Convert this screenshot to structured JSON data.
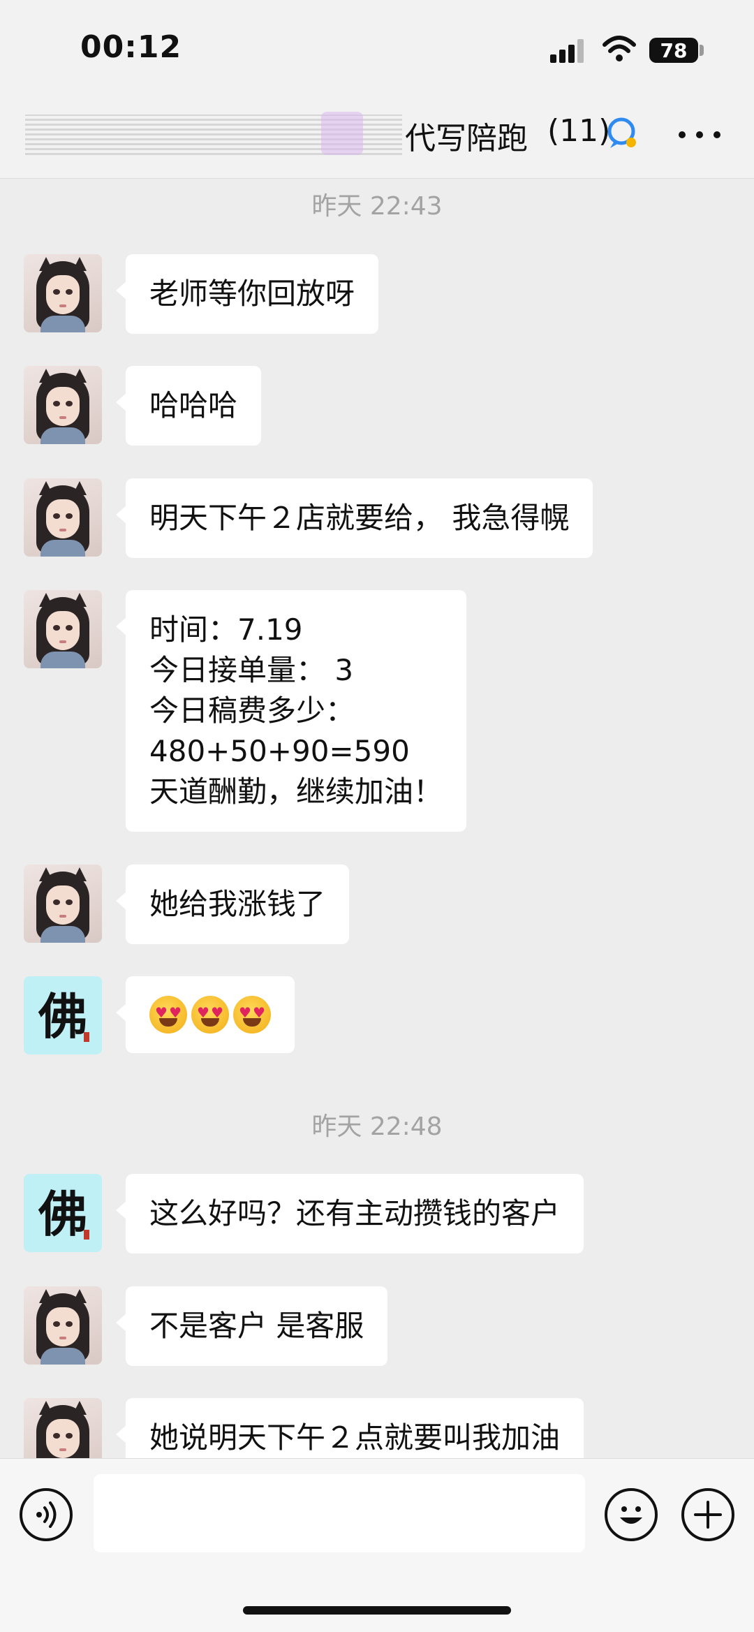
{
  "status_bar": {
    "time": "00:12",
    "battery": "78"
  },
  "header": {
    "title": "代写陪跑",
    "member_count": "(11)"
  },
  "timestamps": [
    "昨天 22:43",
    "昨天 22:48"
  ],
  "messages": [
    {
      "sender": "girl-avatar",
      "lines": [
        "老师等你回放呀"
      ]
    },
    {
      "sender": "girl-avatar",
      "lines": [
        "哈哈哈"
      ]
    },
    {
      "sender": "girl-avatar",
      "lines": [
        "明天下午２店就要给，  我急得幌"
      ]
    },
    {
      "sender": "girl-avatar",
      "lines": [
        "时间：7.19",
        "今日接单量：  3",
        "今日稿费多少：",
        "480+50+90=590",
        "天道酬勤，继续加油！"
      ]
    },
    {
      "sender": "girl-avatar",
      "lines": [
        "她给我涨钱了"
      ]
    },
    {
      "sender": "fo-avatar",
      "emoji": [
        "heart-eyes-emoji",
        "heart-eyes-emoji",
        "heart-eyes-emoji"
      ]
    },
    {
      "sender": "fo-avatar",
      "lines": [
        "这么好吗？还有主动攒钱的客户"
      ]
    },
    {
      "sender": "girl-avatar",
      "lines": [
        "不是客户 是客服"
      ]
    },
    {
      "sender": "girl-avatar",
      "lines": [
        "她说明天下午２点就要叫我加油"
      ]
    }
  ],
  "avatars": {
    "fo_character": "佛"
  },
  "input_bar": {
    "placeholder": ""
  }
}
